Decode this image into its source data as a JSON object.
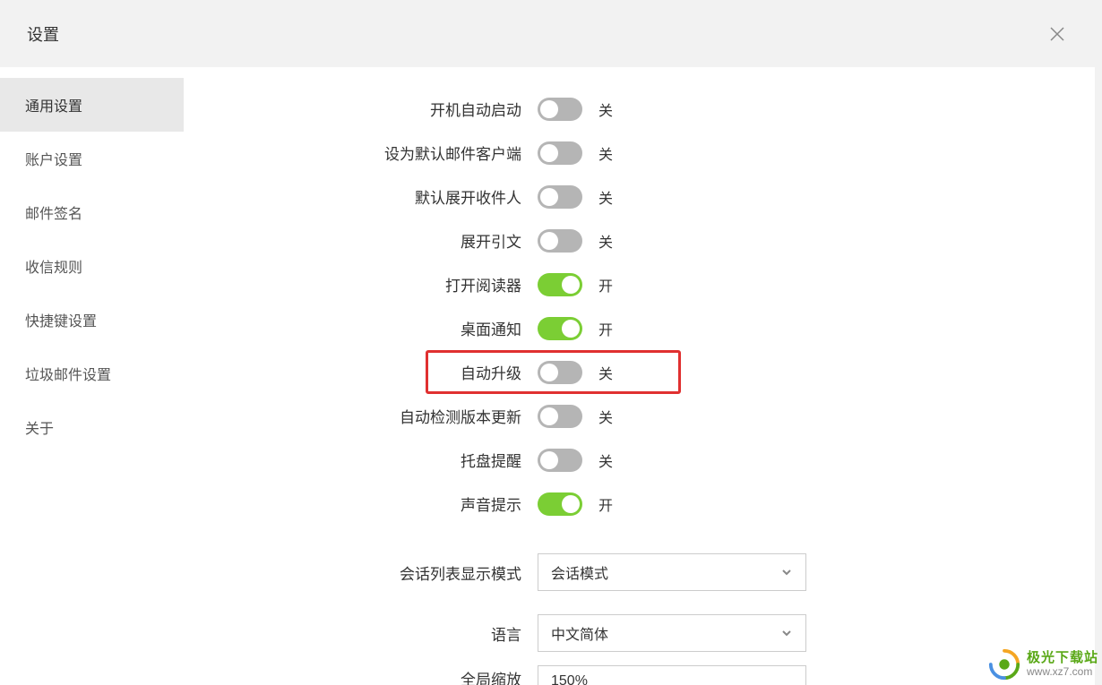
{
  "title": "设置",
  "sidebar": {
    "items": [
      {
        "label": "通用设置",
        "active": true
      },
      {
        "label": "账户设置",
        "active": false
      },
      {
        "label": "邮件签名",
        "active": false
      },
      {
        "label": "收信规则",
        "active": false
      },
      {
        "label": "快捷键设置",
        "active": false
      },
      {
        "label": "垃圾邮件设置",
        "active": false
      },
      {
        "label": "关于",
        "active": false
      }
    ]
  },
  "state_labels": {
    "on": "开",
    "off": "关"
  },
  "toggles": [
    {
      "label": "开机自动启动",
      "on": false
    },
    {
      "label": "设为默认邮件客户端",
      "on": false
    },
    {
      "label": "默认展开收件人",
      "on": false
    },
    {
      "label": "展开引文",
      "on": false
    },
    {
      "label": "打开阅读器",
      "on": true
    },
    {
      "label": "桌面通知",
      "on": true
    },
    {
      "label": "自动升级",
      "on": false,
      "highlighted": true
    },
    {
      "label": "自动检测版本更新",
      "on": false
    },
    {
      "label": "托盘提醒",
      "on": false
    },
    {
      "label": "声音提示",
      "on": true
    }
  ],
  "selects": [
    {
      "label": "会话列表显示模式",
      "value": "会话模式"
    },
    {
      "label": "语言",
      "value": "中文简体"
    },
    {
      "label": "全局缩放",
      "value": "150%",
      "partial": true
    }
  ],
  "watermark": {
    "title": "极光下载站",
    "url": "www.xz7.com"
  }
}
